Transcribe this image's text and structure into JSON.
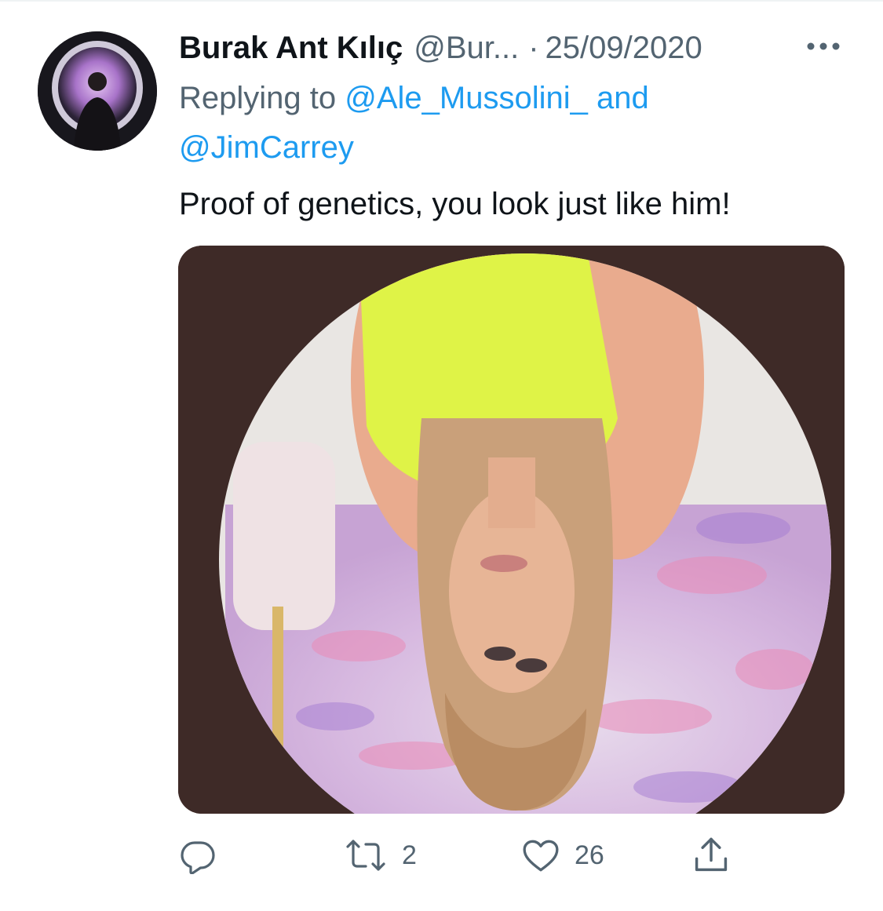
{
  "tweet": {
    "author_name": "Burak Ant Kılıç",
    "author_handle": "@Bur...",
    "separator": "·",
    "date": "25/09/2020",
    "reply_prefix": "Replying to",
    "reply_mention_1": "@Ale_Mussolini_",
    "reply_joiner": "and",
    "reply_mention_2": "@JimCarrey",
    "text": "Proof of genetics, you look just like him!",
    "media_background_color": "#3e2a27"
  },
  "actions": {
    "reply_icon": "reply-icon",
    "retweet_icon": "retweet-icon",
    "retweet_count": "2",
    "like_icon": "heart-icon",
    "like_count": "26",
    "share_icon": "share-icon"
  },
  "colors": {
    "text_primary": "#0f1419",
    "text_secondary": "#536471",
    "link": "#1d9bf0"
  }
}
